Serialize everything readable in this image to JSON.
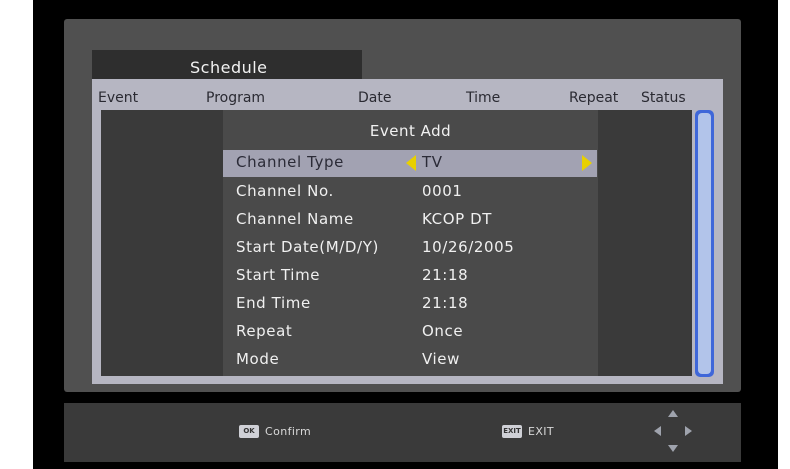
{
  "tab": {
    "label": "Schedule"
  },
  "columns": [
    "Event",
    "Program",
    "Date",
    "Time",
    "Repeat",
    "Status"
  ],
  "dialog": {
    "title": "Event Add",
    "rows": [
      {
        "label": "Channel Type",
        "value": "TV"
      },
      {
        "label": "Channel No.",
        "value": "0001"
      },
      {
        "label": "Channel Name",
        "value": "KCOP DT"
      },
      {
        "label": "Start Date(M/D/Y)",
        "value": "10/26/2005"
      },
      {
        "label": "Start Time",
        "value": "21:18"
      },
      {
        "label": "End Time",
        "value": "21:18"
      },
      {
        "label": "Repeat",
        "value": "Once"
      },
      {
        "label": "Mode",
        "value": "View"
      }
    ]
  },
  "footer": {
    "confirm_key": "OK",
    "confirm_label": "Confirm",
    "exit_key": "EXIT",
    "exit_label": "EXIT"
  },
  "icons": {
    "selector_arrows": "caret-left-right-icon",
    "navigation": "dpad-icon"
  },
  "colors": {
    "selector_arrow": "#e8d000",
    "scrollbar": "#3f67d9",
    "highlight_row": "#a2a2b2"
  }
}
